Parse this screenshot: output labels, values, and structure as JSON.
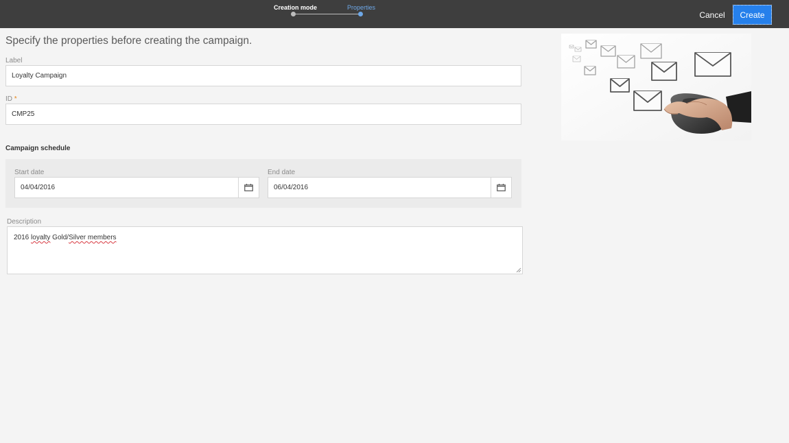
{
  "header": {
    "steps": [
      {
        "label": "Creation mode",
        "state": "done"
      },
      {
        "label": "Properties",
        "state": "active"
      }
    ],
    "cancel_label": "Cancel",
    "create_label": "Create"
  },
  "main": {
    "title": "Specify the properties before creating the campaign.",
    "label_field": {
      "label": "Label",
      "value": "Loyalty Campaign"
    },
    "id_field": {
      "label": "ID",
      "required_mark": "*",
      "value": "CMP25"
    },
    "schedule": {
      "title": "Campaign schedule",
      "start": {
        "label": "Start date",
        "value": "04/04/2016"
      },
      "end": {
        "label": "End date",
        "value": "06/04/2016"
      }
    },
    "description": {
      "label": "Description",
      "parts": [
        "2016 ",
        "loyalty",
        " Gold/",
        "Silver members"
      ]
    }
  },
  "illustration": {
    "icon": "email-campaign-illustration"
  },
  "colors": {
    "header_bg": "#3e3e3e",
    "accent": "#2680eb",
    "active_step": "#6ea8e8",
    "required": "#e68619",
    "page_bg": "#f4f4f4"
  }
}
